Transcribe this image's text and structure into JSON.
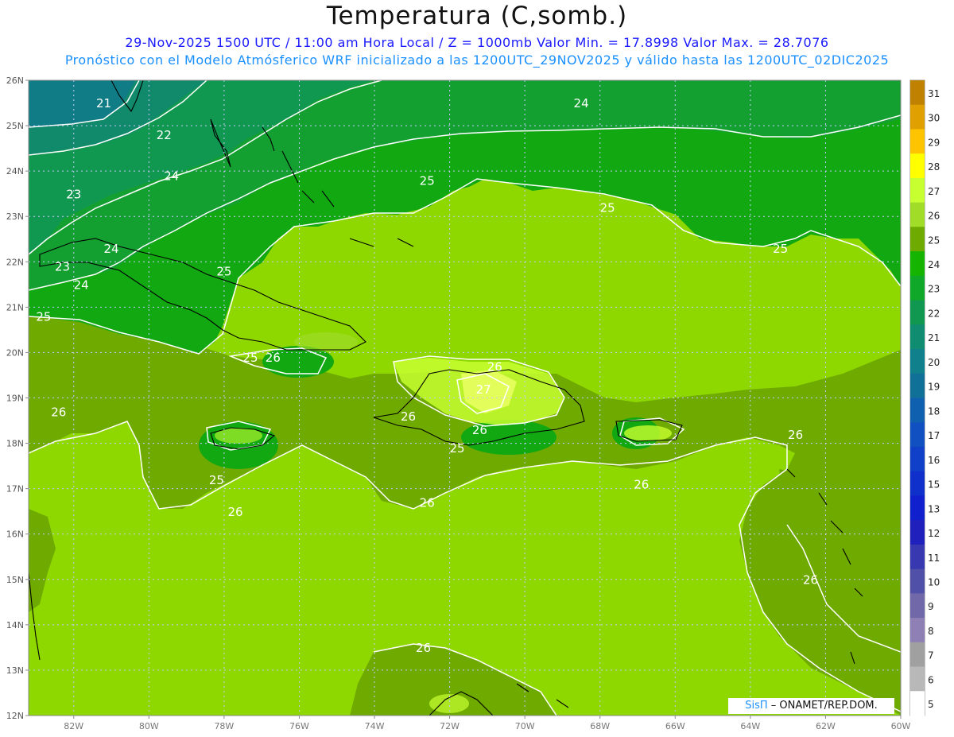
{
  "title": "Temperatura (C,somb.)",
  "subtitle_line1": "29-Nov-2025 1500 UTC / 11:00 am Hora Local / Z = 1000mb  Valor Min. = 17.8998  Valor Max. = 28.7076",
  "subtitle_line2": "Pronóstico con el Modelo Atmósferico WRF inicializado a las 1200UTC_29NOV2025 y válido hasta las  1200UTC_02DIC2025",
  "credit": {
    "brand": "SisΠ",
    "text": " – ONAMET/REP.DOM."
  },
  "map_extent": {
    "lon_min": -83.2,
    "lon_max": -60,
    "lat_min": 12,
    "lat_max": 26
  },
  "lat_labels": [
    "26N",
    "25N",
    "24N",
    "23N",
    "22N",
    "21N",
    "20N",
    "19N",
    "18N",
    "17N",
    "16N",
    "15N",
    "14N",
    "13N",
    "12N"
  ],
  "lon_labels": [
    "82W",
    "80W",
    "78W",
    "76W",
    "74W",
    "72W",
    "70W",
    "68W",
    "66W",
    "64W",
    "62W",
    "60W"
  ],
  "colorbar": {
    "levels": [
      31,
      30,
      29,
      28,
      27,
      26,
      25,
      24,
      23,
      22,
      21,
      20,
      19,
      18,
      17,
      16,
      15,
      13,
      12,
      11,
      10,
      9,
      8,
      7,
      6,
      5
    ],
    "colors": [
      "#c08000",
      "#e0a000",
      "#ffc400",
      "#ffff00",
      "#c8ff30",
      "#a0dc28",
      "#6eaa00",
      "#14b400",
      "#10a828",
      "#109850",
      "#108c70",
      "#10808c",
      "#107098",
      "#1060b0",
      "#1050c0",
      "#1040c8",
      "#1030cc",
      "#1020cc",
      "#2020bc",
      "#3838b0",
      "#5050a8",
      "#7068a8",
      "#8e80b4",
      "#a0a0a0",
      "#b8b8b8",
      "#ffffff"
    ]
  },
  "fill_colors": {
    "t26_plus": "#8ed800",
    "t25_26": "#6eaa00",
    "t24_25": "#12a812",
    "t23_24": "#14a030",
    "t22_23": "#109850",
    "t21_22": "#108a6a",
    "t20_21": "#107c86",
    "land_hot": "#c8ff30"
  },
  "contour_labels": [
    {
      "text": "21",
      "lon": -81.2,
      "lat": 25.4
    },
    {
      "text": "22",
      "lon": -79.6,
      "lat": 24.7
    },
    {
      "text": "23",
      "lon": -82.0,
      "lat": 23.4
    },
    {
      "text": "24",
      "lon": -79.4,
      "lat": 23.8
    },
    {
      "text": "24",
      "lon": -68.5,
      "lat": 25.4
    },
    {
      "text": "25",
      "lon": -72.6,
      "lat": 23.7
    },
    {
      "text": "25",
      "lon": -67.8,
      "lat": 23.1
    },
    {
      "text": "25",
      "lon": -63.2,
      "lat": 22.2
    },
    {
      "text": "24",
      "lon": -81.0,
      "lat": 22.2
    },
    {
      "text": "23",
      "lon": -82.3,
      "lat": 21.8
    },
    {
      "text": "24",
      "lon": -81.8,
      "lat": 21.4
    },
    {
      "text": "25",
      "lon": -78.0,
      "lat": 21.7
    },
    {
      "text": "25",
      "lon": -82.8,
      "lat": 20.7
    },
    {
      "text": "25",
      "lon": -77.3,
      "lat": 19.8
    },
    {
      "text": "26",
      "lon": -76.7,
      "lat": 19.8
    },
    {
      "text": "26",
      "lon": -70.8,
      "lat": 19.6
    },
    {
      "text": "27",
      "lon": -71.1,
      "lat": 19.1
    },
    {
      "text": "26",
      "lon": -73.1,
      "lat": 18.5
    },
    {
      "text": "26",
      "lon": -71.2,
      "lat": 18.2
    },
    {
      "text": "25",
      "lon": -71.8,
      "lat": 17.8
    },
    {
      "text": "26",
      "lon": -82.4,
      "lat": 18.6
    },
    {
      "text": "25",
      "lon": -78.2,
      "lat": 17.1
    },
    {
      "text": "26",
      "lon": -72.6,
      "lat": 16.6
    },
    {
      "text": "26",
      "lon": -77.7,
      "lat": 16.4
    },
    {
      "text": "26",
      "lon": -66.9,
      "lat": 17.0
    },
    {
      "text": "26",
      "lon": -62.8,
      "lat": 18.1
    },
    {
      "text": "26",
      "lon": -62.4,
      "lat": 14.9
    },
    {
      "text": "26",
      "lon": -72.7,
      "lat": 13.4
    }
  ],
  "icons": {
    "north_arrow": "none"
  }
}
